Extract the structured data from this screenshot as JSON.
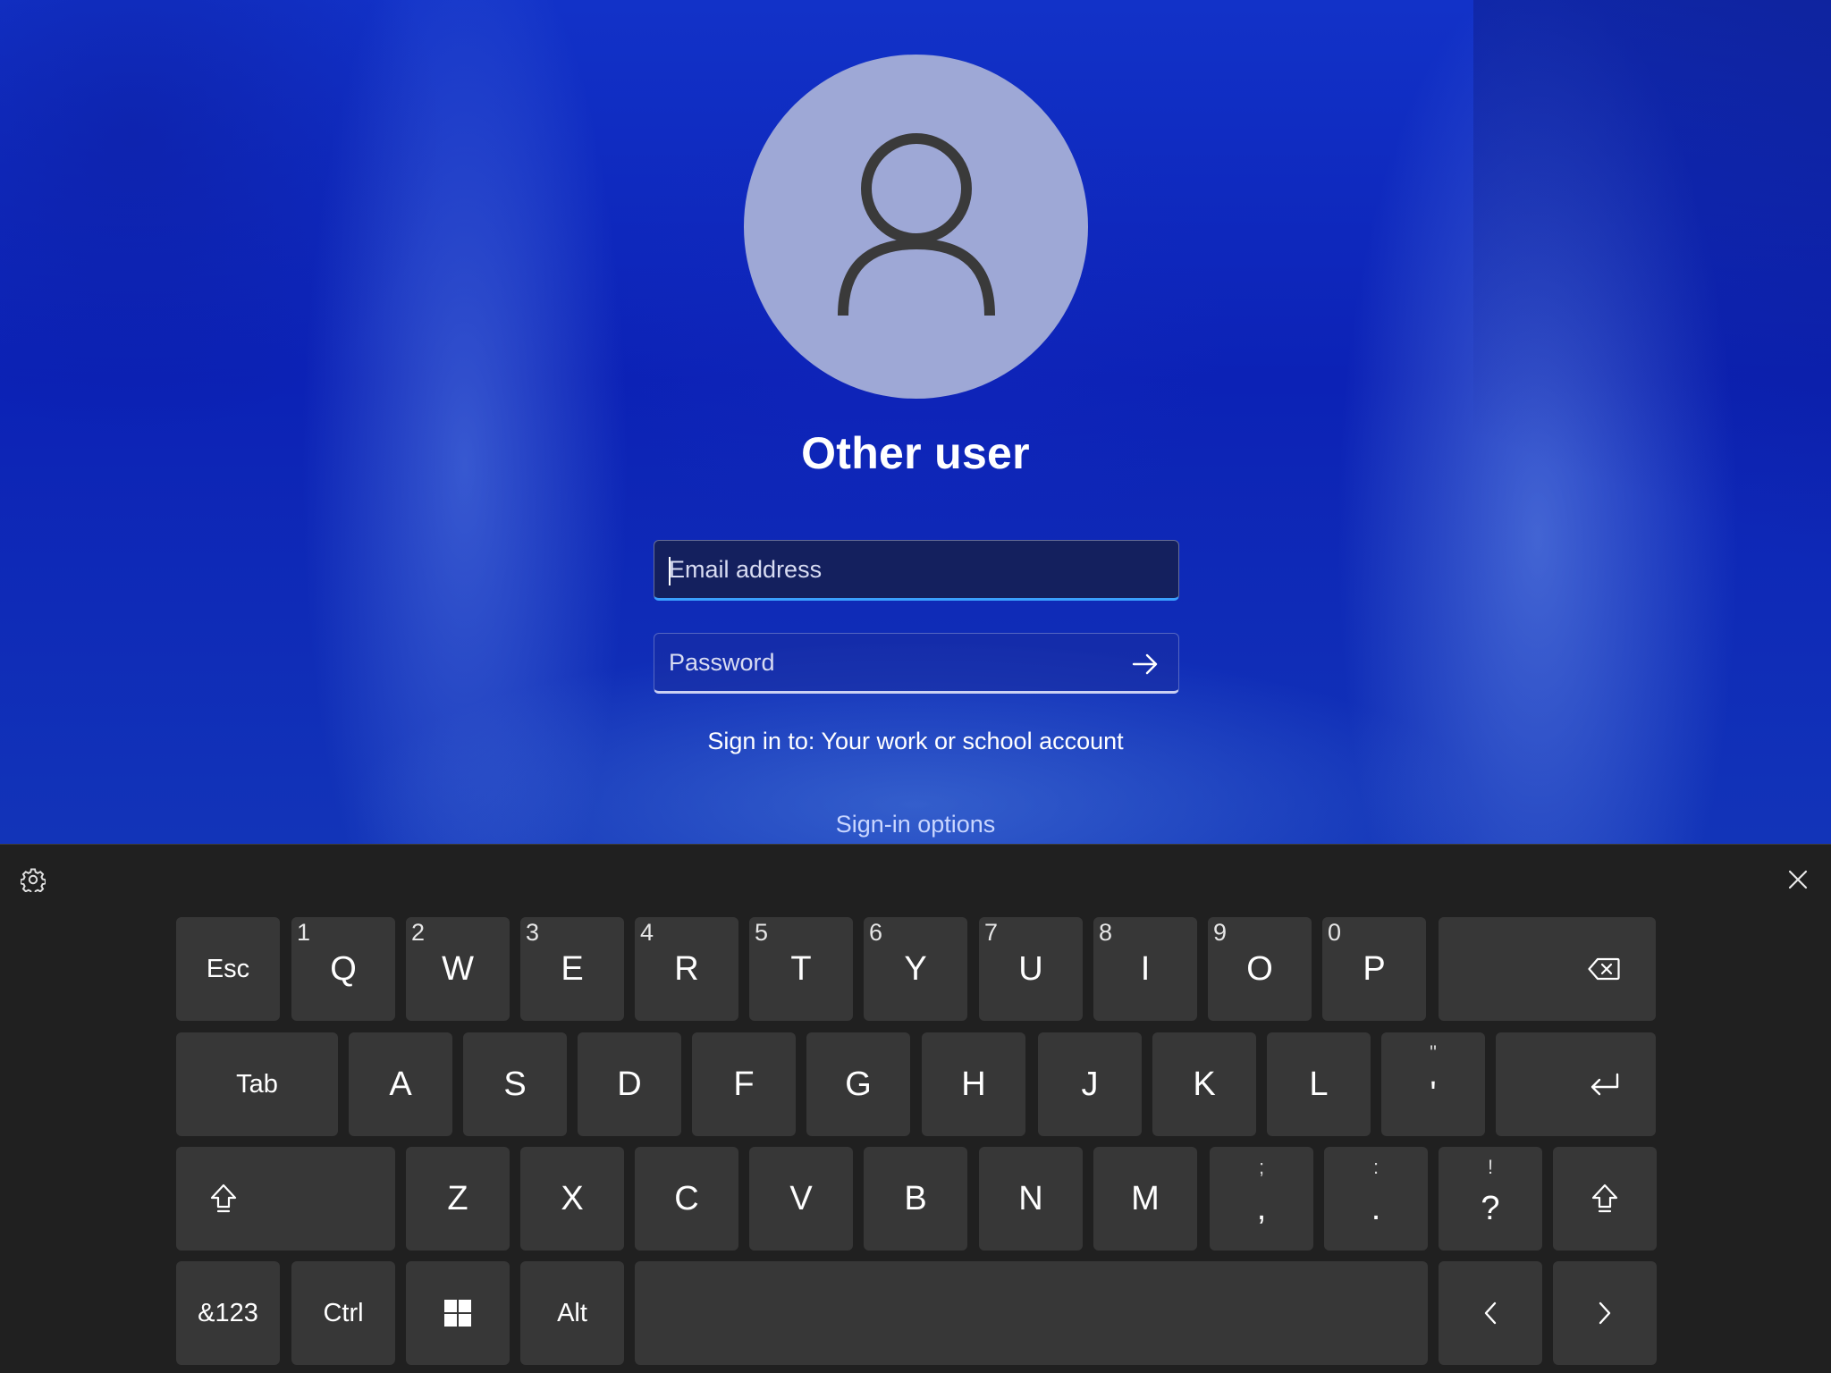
{
  "lock_screen": {
    "user_name": "Other user",
    "email_placeholder": "Email address",
    "password_placeholder": "Password",
    "sign_in_to": "Sign in to: Your work or school account",
    "sign_in_options": "Sign-in options"
  },
  "keyboard": {
    "settings_icon": "gear-icon",
    "close_icon": "close-icon",
    "row1": [
      {
        "label": "Esc"
      },
      {
        "label": "Q",
        "num": "1"
      },
      {
        "label": "W",
        "num": "2"
      },
      {
        "label": "E",
        "num": "3"
      },
      {
        "label": "R",
        "num": "4"
      },
      {
        "label": "T",
        "num": "5"
      },
      {
        "label": "Y",
        "num": "6"
      },
      {
        "label": "U",
        "num": "7"
      },
      {
        "label": "I",
        "num": "8"
      },
      {
        "label": "O",
        "num": "9"
      },
      {
        "label": "P",
        "num": "0"
      }
    ],
    "row2": [
      {
        "label": "Tab"
      },
      {
        "label": "A"
      },
      {
        "label": "S"
      },
      {
        "label": "D"
      },
      {
        "label": "F"
      },
      {
        "label": "G"
      },
      {
        "label": "H"
      },
      {
        "label": "J"
      },
      {
        "label": "K"
      },
      {
        "label": "L"
      },
      {
        "top": "\"",
        "bottom": "'"
      }
    ],
    "row3": [
      {
        "label": "Z"
      },
      {
        "label": "X"
      },
      {
        "label": "C"
      },
      {
        "label": "V"
      },
      {
        "label": "B"
      },
      {
        "label": "N"
      },
      {
        "label": "M"
      },
      {
        "top": ";",
        "bottom": ","
      },
      {
        "top": ":",
        "bottom": "."
      },
      {
        "top": "!",
        "bottom": "?"
      }
    ],
    "row4": [
      {
        "label": "&123"
      },
      {
        "label": "Ctrl"
      },
      {
        "label": "Alt"
      }
    ],
    "icons": {
      "backspace": "backspace-icon",
      "enter": "enter-icon",
      "shift": "shift-icon",
      "windows": "windows-logo-icon",
      "left": "chevron-left-icon",
      "right": "chevron-right-icon"
    }
  }
}
